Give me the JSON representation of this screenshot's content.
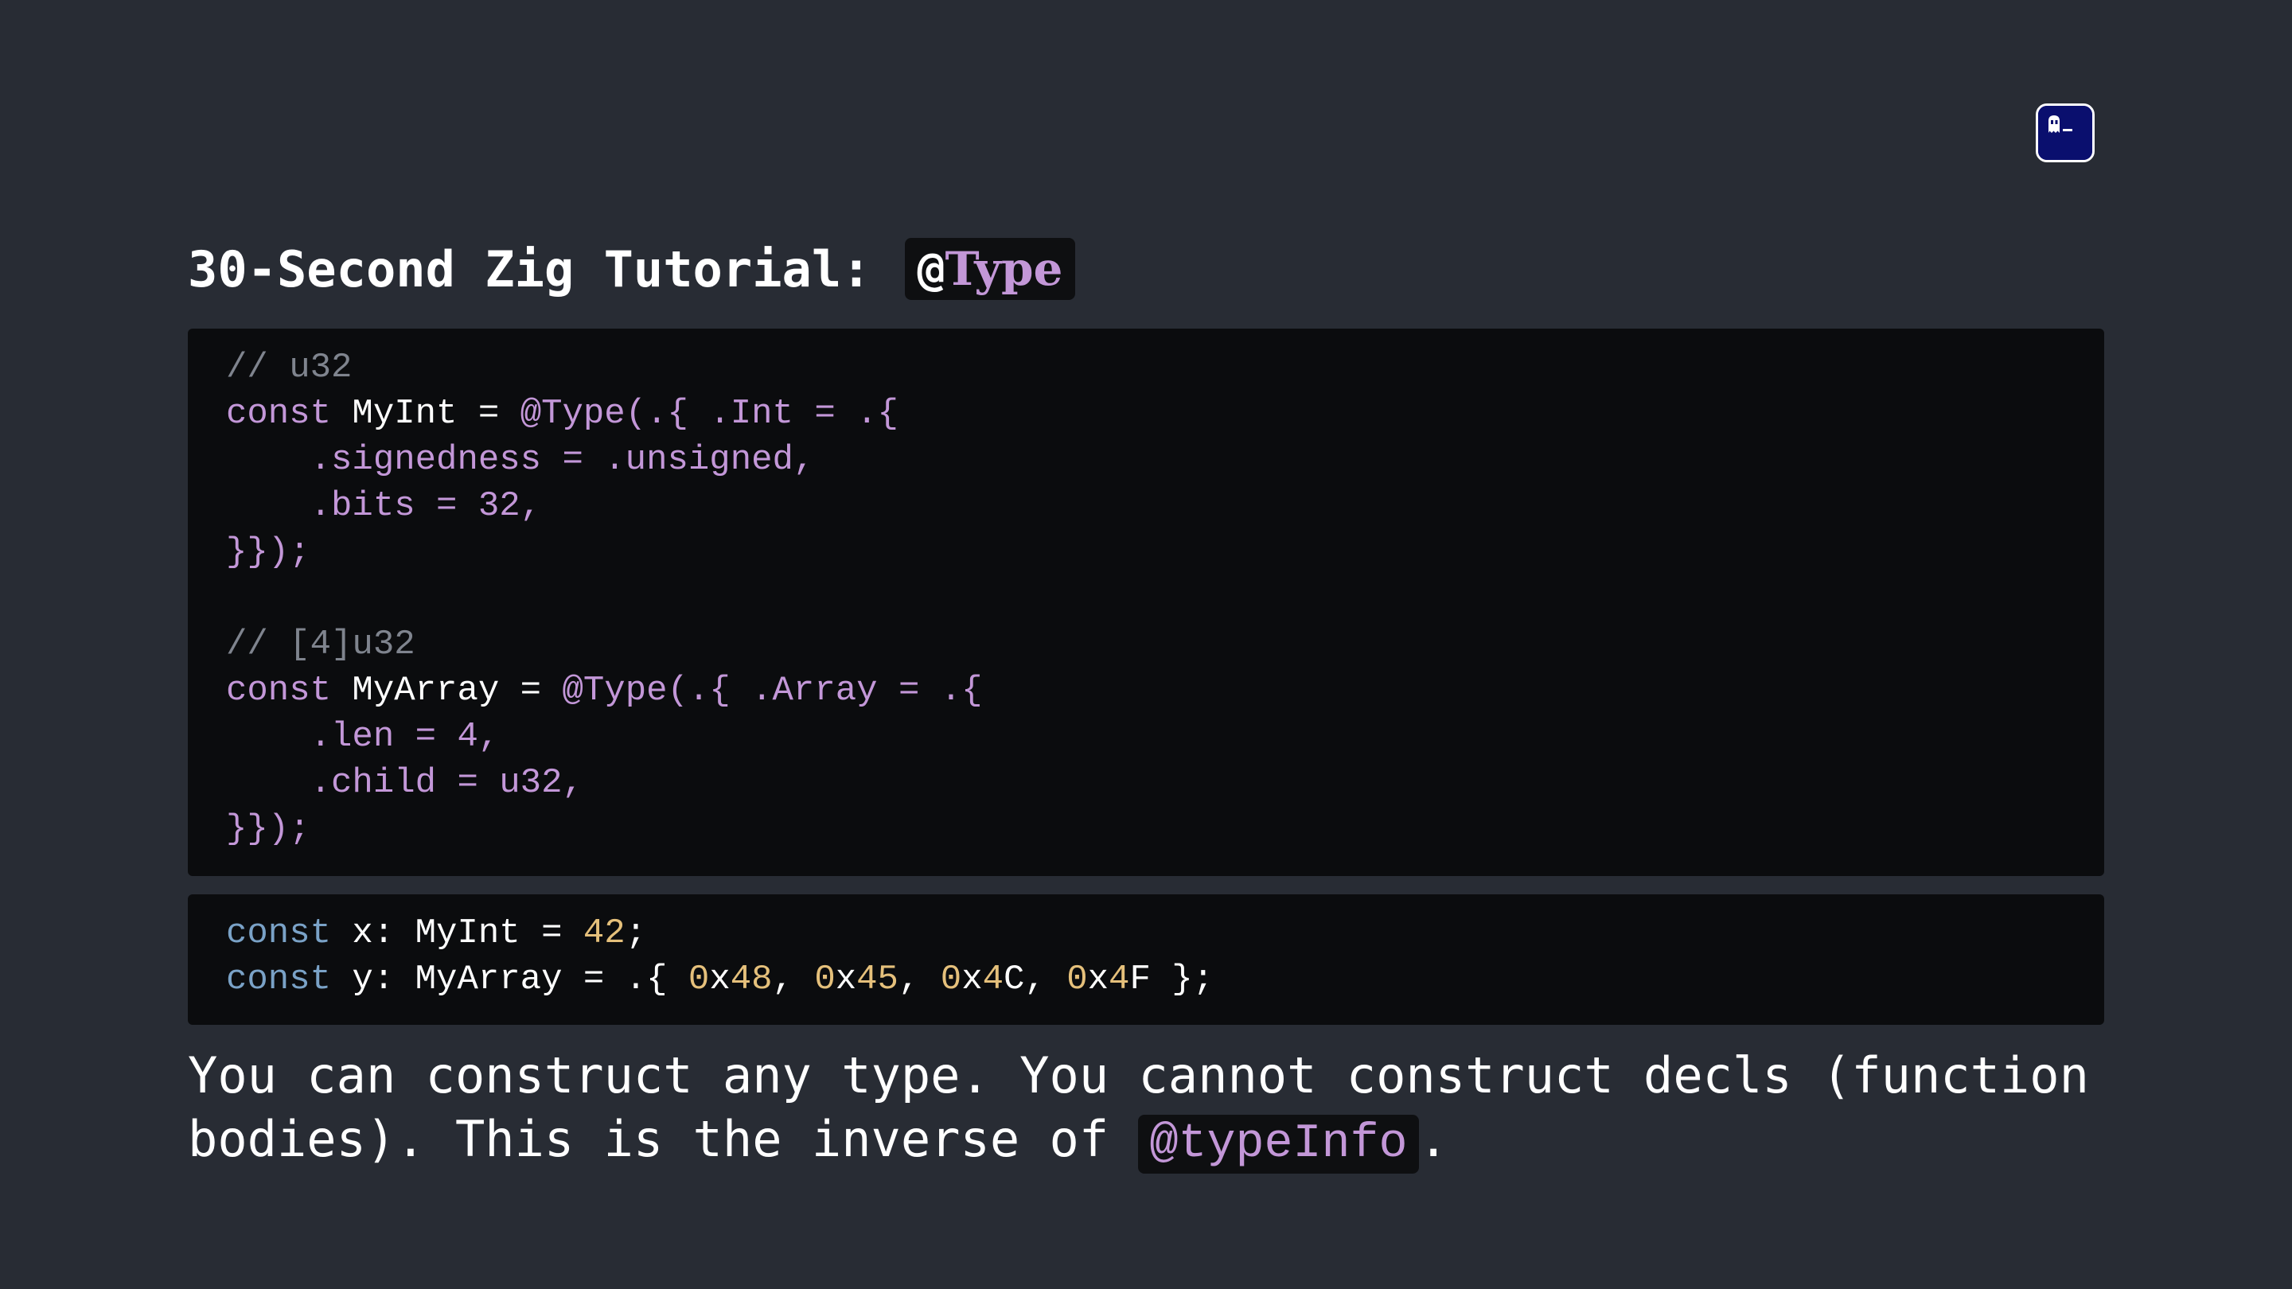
{
  "icons": {
    "app": "terminal-ghost-icon"
  },
  "colors": {
    "background": "#282c34",
    "code_background": "#0b0c0e",
    "keyword": "#c397d8",
    "keyword_blue": "#7aa2c7",
    "number": "#e5c07b",
    "comment": "#7f848e",
    "app_icon": "#0a0f6e"
  },
  "title": {
    "text": "30-Second Zig Tutorial:",
    "code_at": "@",
    "code_name": "Type"
  },
  "code_main": {
    "line1": "// u32",
    "line2": {
      "kw": "const",
      "name": " MyInt",
      "op": " = ",
      "call": "@Type(.{ .Int = .{"
    },
    "line3": "    .signedness = .unsigned,",
    "line4": "    .bits = 32,",
    "line5": "}});",
    "line7": "// [4]u32",
    "line8": {
      "kw": "const",
      "name": " MyArray",
      "op": " = ",
      "call": "@Type(.{ .Array = .{"
    },
    "line9": "    .len = 4,",
    "line10": "    .child = u32,",
    "line11": "}});"
  },
  "code_usage": {
    "line1": {
      "kw": "const",
      "rest": " x: MyInt = ",
      "num": "42",
      "end": ";"
    },
    "line2": {
      "kw": "const",
      "rest": " y: MyArray = .{ ",
      "h1a": "0",
      "h1b": "x",
      "h1c": "48",
      "s1": ", ",
      "h2a": "0",
      "h2b": "x",
      "h2c": "45",
      "s2": ", ",
      "h3a": "0",
      "h3b": "x",
      "h3c": "4",
      "h3d": "C",
      "s3": ", ",
      "h4a": "0",
      "h4b": "x",
      "h4c": "4",
      "h4d": "F",
      "end": " };"
    }
  },
  "caption": {
    "text_before": "You can construct any type. You cannot construct decls (function bodies). This is the inverse of ",
    "code": "@typeInfo",
    "text_after": "."
  }
}
